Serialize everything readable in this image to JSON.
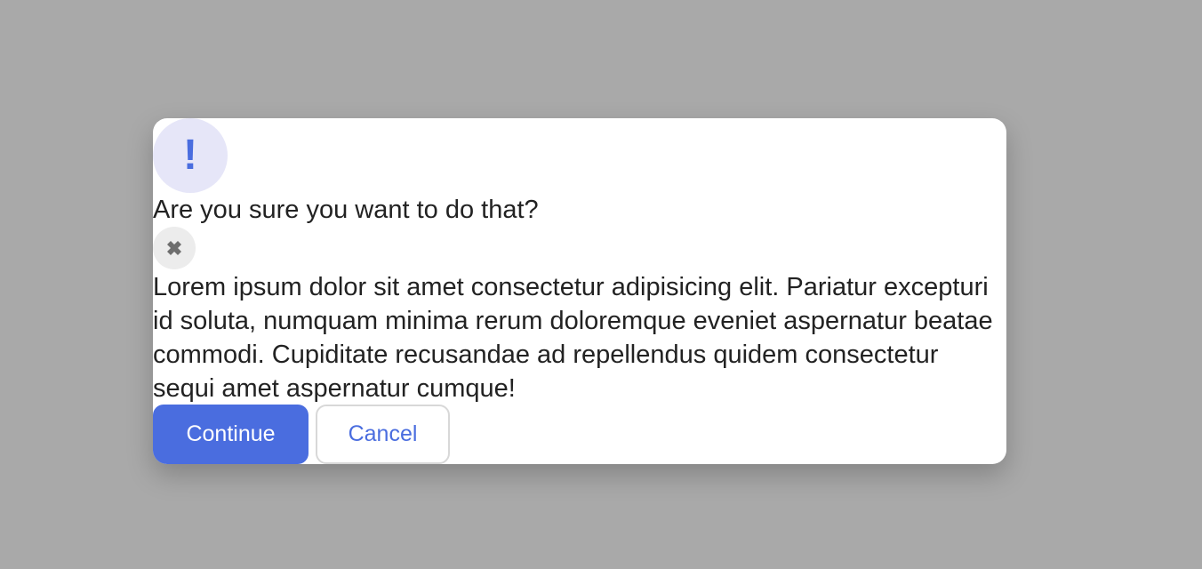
{
  "dialog": {
    "alert_icon_glyph": "!",
    "alert_icon_name": "exclamation-icon",
    "title": "Are you sure you want to do that?",
    "close_icon_name": "close-icon",
    "message": "Lorem ipsum dolor sit amet consectetur adipisicing elit. Pariatur excepturi id soluta, numquam minima rerum doloremque eveniet aspernatur beatae commodi. Cupiditate recusandae ad repellendus quidem consectetur sequi amet aspernatur cumque!",
    "buttons": {
      "continue_label": "Continue",
      "cancel_label": "Cancel"
    }
  },
  "colors": {
    "accent": "#4a6ddf",
    "overlay": "#a9a9a9",
    "icon_bg": "#e6e6f8"
  }
}
